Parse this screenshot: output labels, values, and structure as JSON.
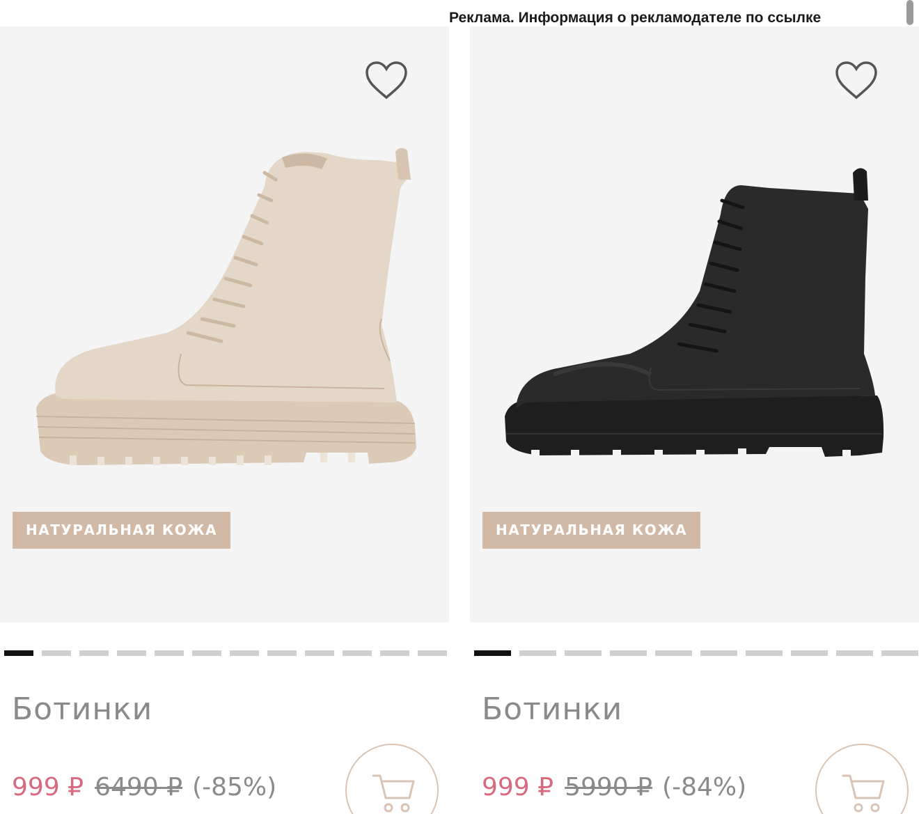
{
  "ad_notice": "Реклама. Информация о рекламодателе по ссылке",
  "colors": {
    "badge_bg": "#d2b9a6",
    "price_current": "#d86a80",
    "muted_text": "#8a8a8a",
    "card_bg": "#f4f4f4",
    "cart_ring": "#d9c3b4"
  },
  "products": [
    {
      "name": "Ботинки",
      "badge": "НАТУРАЛЬНАЯ КОЖА",
      "price_current": "999 ₽",
      "price_old": "6490 ₽",
      "discount": "(-85%)",
      "boot_color": "beige",
      "favorite_icon": "heart-outline-icon",
      "cart_icon": "shopping-cart-icon",
      "carousel": {
        "total": 12,
        "active_index": 0
      }
    },
    {
      "name": "Ботинки",
      "badge": "НАТУРАЛЬНАЯ КОЖА",
      "price_current": "999 ₽",
      "price_old": "5990 ₽",
      "discount": "(-84%)",
      "boot_color": "black",
      "favorite_icon": "heart-outline-icon",
      "cart_icon": "shopping-cart-icon",
      "carousel": {
        "total": 10,
        "active_index": 0
      }
    }
  ]
}
